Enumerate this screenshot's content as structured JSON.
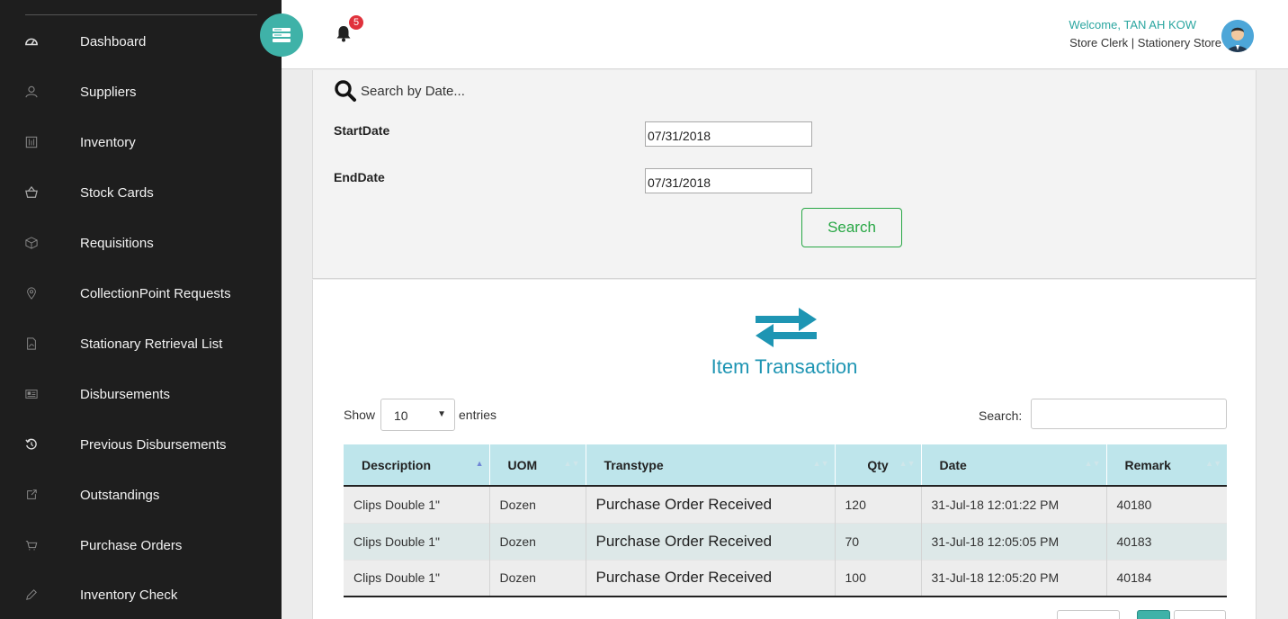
{
  "sidebar": {
    "items": [
      {
        "label": "Dashboard",
        "icon": "dashboard-icon"
      },
      {
        "label": "Suppliers",
        "icon": "user-icon"
      },
      {
        "label": "Inventory",
        "icon": "inventory-icon"
      },
      {
        "label": "Stock Cards",
        "icon": "basket-icon"
      },
      {
        "label": "Requisitions",
        "icon": "box-icon"
      },
      {
        "label": "CollectionPoint Requests",
        "icon": "location-pin-icon"
      },
      {
        "label": "Stationary Retrieval List",
        "icon": "pdf-file-icon"
      },
      {
        "label": "Disbursements",
        "icon": "newspaper-icon"
      },
      {
        "label": "Previous Disbursements",
        "icon": "history-icon"
      },
      {
        "label": "Outstandings",
        "icon": "external-link-icon"
      },
      {
        "label": "Purchase Orders",
        "icon": "cart-icon"
      },
      {
        "label": "Inventory Check",
        "icon": "pencil-icon"
      }
    ]
  },
  "header": {
    "notification_count": "5",
    "welcome": "Welcome, TAN AH KOW",
    "role": "Store Clerk | Stationery Store"
  },
  "search_panel": {
    "heading": "Search by Date...",
    "start_label": "StartDate",
    "start_value": "07/31/2018",
    "end_label": "EndDate",
    "end_value": "07/31/2018",
    "button_label": "Search"
  },
  "transactions": {
    "title": "Item Transaction",
    "show_label": "Show",
    "page_length": "10",
    "entries_label": "entries",
    "search_label": "Search:",
    "columns": [
      "Description",
      "UOM",
      "Transtype",
      "Qty",
      "Date",
      "Remark"
    ],
    "rows": [
      {
        "description": "Clips Double 1\"",
        "uom": "Dozen",
        "transtype": "Purchase Order Received",
        "qty": "120",
        "date": "31-Jul-18 12:01:22 PM",
        "remark": "40180"
      },
      {
        "description": "Clips Double 1\"",
        "uom": "Dozen",
        "transtype": "Purchase Order Received",
        "qty": "70",
        "date": "31-Jul-18 12:05:05 PM",
        "remark": "40183"
      },
      {
        "description": "Clips Double 1\"",
        "uom": "Dozen",
        "transtype": "Purchase Order Received",
        "qty": "100",
        "date": "31-Jul-18 12:05:20 PM",
        "remark": "40184"
      }
    ]
  },
  "colors": {
    "sidebar_bg": "#1e1e1e",
    "accent_teal": "#3fb2a8",
    "title_blue": "#1e95b3",
    "table_header": "#bee5eb",
    "search_green": "#28a745",
    "badge_red": "#e0323c"
  }
}
